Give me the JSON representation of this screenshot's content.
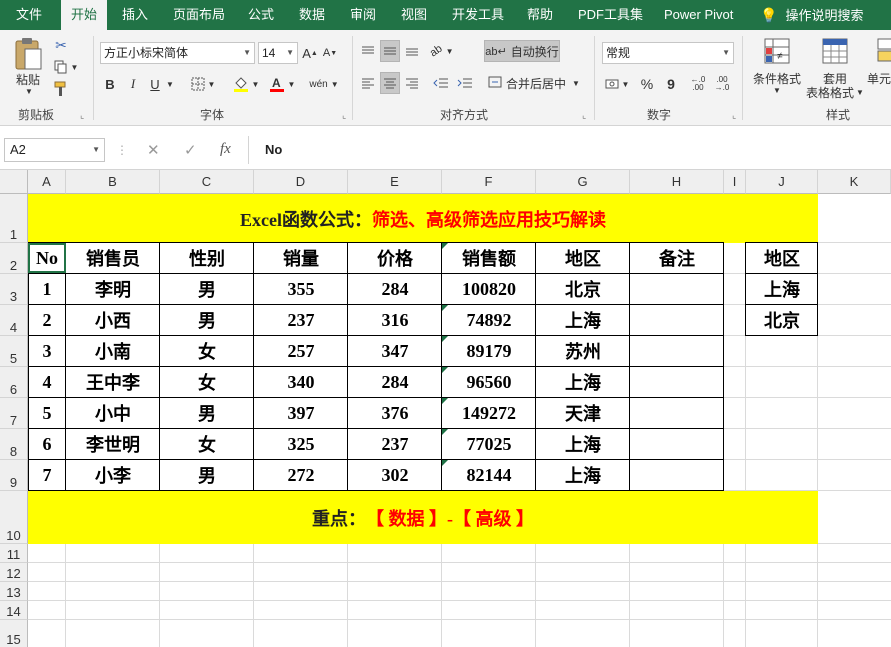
{
  "menu": {
    "tabs": [
      "文件",
      "开始",
      "插入",
      "页面布局",
      "公式",
      "数据",
      "审阅",
      "视图",
      "开发工具",
      "帮助",
      "PDF工具集",
      "Power Pivot"
    ],
    "active": "开始",
    "search_label": "操作说明搜索"
  },
  "ribbon": {
    "clipboard": {
      "paste_label": "粘贴",
      "group_label": "剪贴板"
    },
    "font": {
      "font_name": "方正小标宋简体",
      "font_size": "14",
      "bold": "B",
      "italic": "I",
      "underline": "U",
      "phonetic": "wén",
      "group_label": "字体"
    },
    "alignment": {
      "wrap_text": "自动换行",
      "merge_center": "合并后居中",
      "group_label": "对齐方式"
    },
    "number": {
      "format": "常规",
      "percent": "%",
      "comma": "9",
      "group_label": "数字"
    },
    "styles": {
      "cond_format": "条件格式",
      "table_format_1": "套用",
      "table_format_2": "表格格式",
      "cell_styles": "单元",
      "group_label": "样式"
    }
  },
  "formula_bar": {
    "name_box": "A2",
    "fx": "fx",
    "content": "No"
  },
  "sheet": {
    "columns": [
      "A",
      "B",
      "C",
      "D",
      "E",
      "F",
      "G",
      "H",
      "I",
      "J",
      "K"
    ],
    "rows": [
      "1",
      "2",
      "3",
      "4",
      "5",
      "6",
      "7",
      "8",
      "9",
      "10",
      "11",
      "12",
      "13",
      "14",
      "15"
    ],
    "title_black": "Excel函数公式：",
    "title_red": "筛选、高级筛选应用技巧解读",
    "headers": [
      "No",
      "销售员",
      "性别",
      "销量",
      "价格",
      "销售额",
      "地区",
      "备注"
    ],
    "data": [
      [
        "1",
        "李明",
        "男",
        "355",
        "284",
        "100820",
        "北京",
        ""
      ],
      [
        "2",
        "小西",
        "男",
        "237",
        "316",
        "74892",
        "上海",
        ""
      ],
      [
        "3",
        "小南",
        "女",
        "257",
        "347",
        "89179",
        "苏州",
        ""
      ],
      [
        "4",
        "王中李",
        "女",
        "340",
        "284",
        "96560",
        "上海",
        ""
      ],
      [
        "5",
        "小中",
        "男",
        "397",
        "376",
        "149272",
        "天津",
        ""
      ],
      [
        "6",
        "李世明",
        "女",
        "325",
        "237",
        "77025",
        "上海",
        ""
      ],
      [
        "7",
        "小李",
        "男",
        "272",
        "302",
        "82144",
        "上海",
        ""
      ]
    ],
    "criteria": [
      "地区",
      "上海",
      "北京"
    ],
    "footer_black": "重点：",
    "footer_red": "【 数据 】-【 高级 】"
  },
  "colors": {
    "excel_green": "#217346",
    "highlight": "#ffff00",
    "accent_red": "#ff0000"
  }
}
